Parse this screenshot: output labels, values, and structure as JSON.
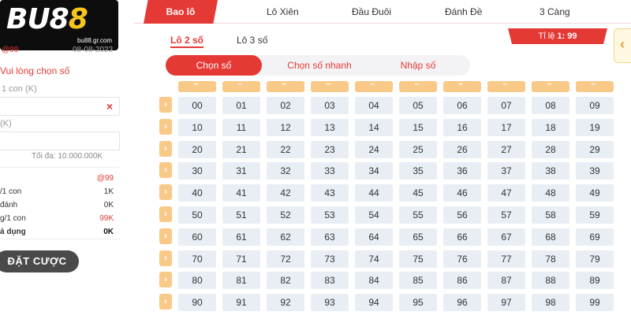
{
  "brand": {
    "logo_main": "BU8",
    "logo_accent": "8",
    "logo_sub": "bu88.gr.com"
  },
  "left_panel": {
    "pay_ratio": "@99",
    "date": "08-08-2023",
    "choose_prompt": "Vui lòng chọn số",
    "per_con_label": "1 con (K)",
    "clear_icon": "×",
    "k_label": "(K)",
    "max_label": "Tối đa: 10.000.000K",
    "summary": [
      {
        "label": "",
        "value": "@99",
        "value_color": "#e53935"
      },
      {
        "label": "/1 con",
        "value": "1K",
        "value_color": "#333333"
      },
      {
        "label": "đánh",
        "value": "0K",
        "value_color": "#333333"
      },
      {
        "label": "g/1 con",
        "value": "99K",
        "value_color": "#e53935"
      },
      {
        "label": "ả dụng",
        "value": "0K",
        "value_color": "#111111",
        "bold": true
      }
    ],
    "bet_button": "ĐẶT CƯỢC"
  },
  "tabs": [
    "Bao lô",
    "Lô Xiên",
    "Đầu Đuôi",
    "Đánh Đề",
    "3 Càng"
  ],
  "sub_tabs": [
    "Lô 2 số",
    "Lô 3 số"
  ],
  "ratio": {
    "label": "Tỉ lệ",
    "value": "1: 99"
  },
  "side_toggle": "‹",
  "modes": [
    "Chọn số",
    "Chọn số nhanh",
    "Nhập số"
  ],
  "grid": {
    "rows": [
      [
        "00",
        "01",
        "02",
        "03",
        "04",
        "05",
        "06",
        "07",
        "08",
        "09"
      ],
      [
        "10",
        "11",
        "12",
        "13",
        "14",
        "15",
        "16",
        "17",
        "18",
        "19"
      ],
      [
        "20",
        "21",
        "22",
        "23",
        "24",
        "25",
        "26",
        "27",
        "28",
        "29"
      ],
      [
        "30",
        "31",
        "32",
        "33",
        "34",
        "35",
        "36",
        "37",
        "38",
        "39"
      ],
      [
        "40",
        "41",
        "42",
        "43",
        "44",
        "45",
        "46",
        "47",
        "48",
        "49"
      ],
      [
        "50",
        "51",
        "52",
        "53",
        "54",
        "55",
        "56",
        "57",
        "58",
        "59"
      ],
      [
        "60",
        "61",
        "62",
        "63",
        "64",
        "65",
        "66",
        "67",
        "68",
        "69"
      ],
      [
        "70",
        "71",
        "72",
        "73",
        "74",
        "75",
        "76",
        "77",
        "78",
        "79"
      ],
      [
        "80",
        "81",
        "82",
        "83",
        "84",
        "85",
        "86",
        "87",
        "88",
        "89"
      ],
      [
        "90",
        "91",
        "92",
        "93",
        "94",
        "95",
        "96",
        "97",
        "98",
        "99"
      ]
    ]
  },
  "colors": {
    "accent": "#e53935",
    "chevron_fill": "#f9c987",
    "cell_bg": "#e9eef5"
  }
}
